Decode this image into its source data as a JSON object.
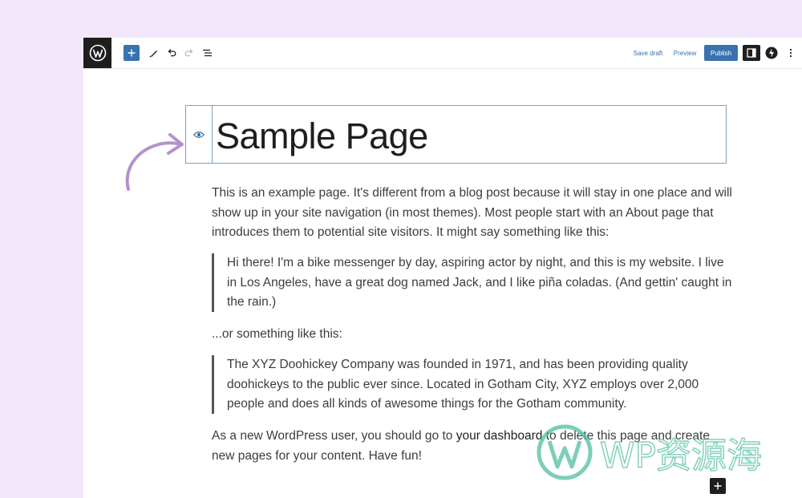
{
  "toolbar": {
    "save_draft_label": "Save draft",
    "preview_label": "Preview",
    "publish_label": "Publish"
  },
  "title_block": {
    "title": "Sample Page"
  },
  "content": {
    "intro": "This is an example page. It's different from a blog post because it will stay in one place and will show up in your site navigation (in most themes). Most people start with an About page that introduces them to potential site visitors. It might say something like this:",
    "quote1": "Hi there! I'm a bike messenger by day, aspiring actor by night, and this is my website. I live in Los Angeles, have a great dog named Jack, and I like piña coladas. (And gettin' caught in the rain.)",
    "middle": "...or something like this:",
    "quote2": "The XYZ Doohickey Company was founded in 1971, and has been providing quality doohickeys to the public ever since. Located in Gotham City, XYZ employs over 2,000 people and does all kinds of awesome things for the Gotham community.",
    "closing_prefix": "As a new WordPress user, you should go to ",
    "closing_link": "your dashboard",
    "closing_suffix": " to delete this page and create new pages for your content. Have fun!"
  },
  "watermark": {
    "text": "WP资源海"
  },
  "colors": {
    "accent": "#3a72b0",
    "background": "#f3e8fb",
    "arrow": "#b392cc"
  }
}
